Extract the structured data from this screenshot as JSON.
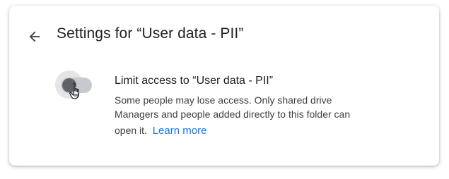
{
  "dialog": {
    "title": "Settings for “User data - PII”",
    "back_icon": "arrow-left-icon"
  },
  "setting": {
    "label": "Limit access to “User data - PII”",
    "description_line1": "Some people may lose access. Only shared drive",
    "description_line2": "Managers and people added directly to this folder can",
    "description_line3": "open it.",
    "learn_more": "Learn more",
    "toggle_state": "off",
    "cursor_icon": "hand-pointer-icon"
  },
  "colors": {
    "link": "#1a73e8",
    "track": "#c6cacf",
    "thumb": "#5f6368",
    "title_text": "#202124"
  }
}
